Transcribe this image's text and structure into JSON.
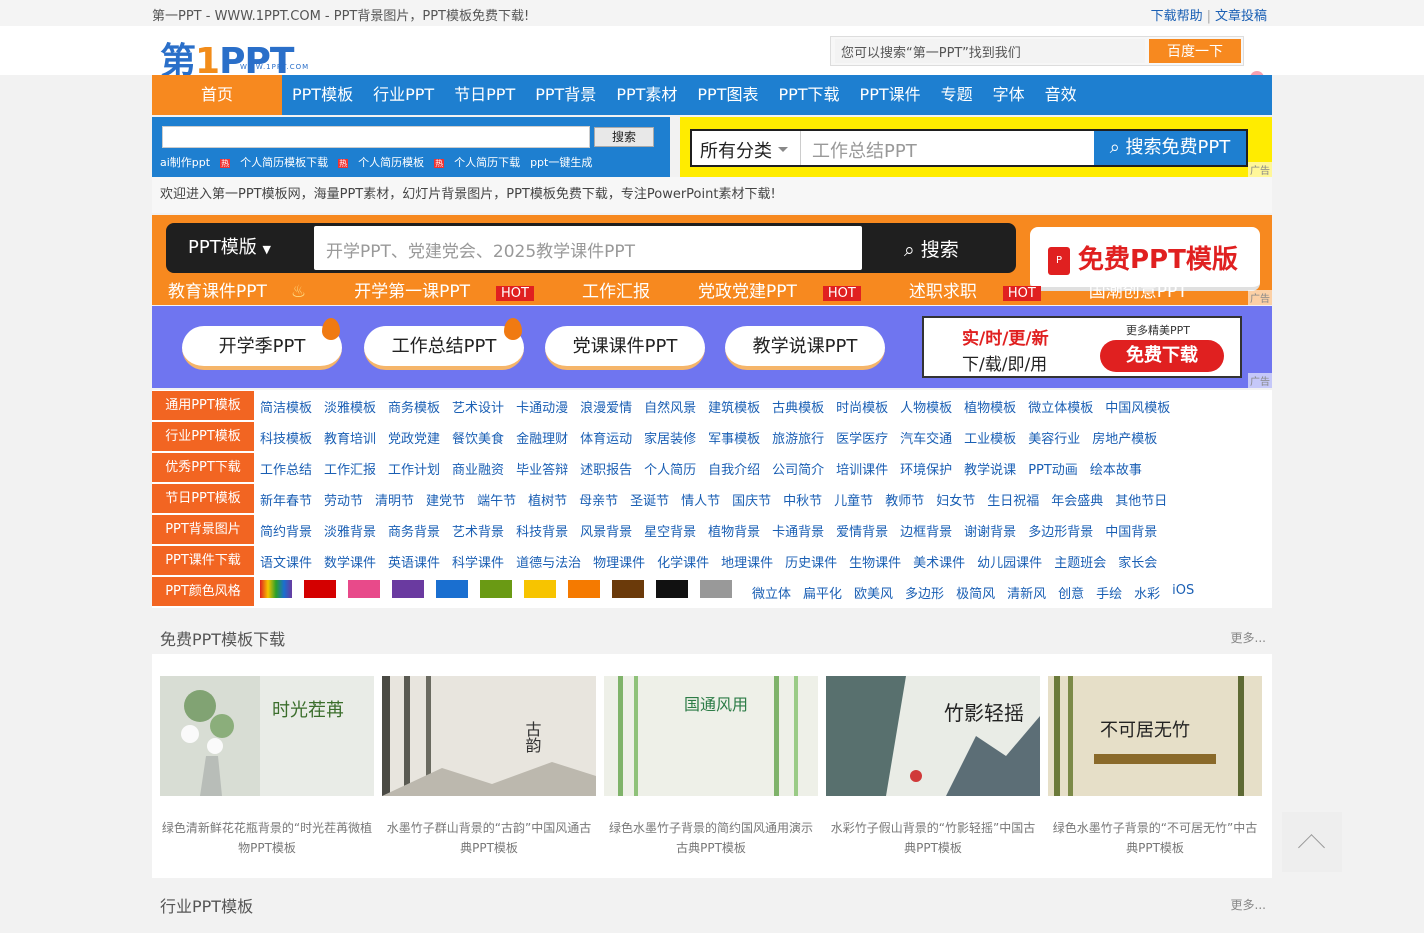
{
  "topbar": {
    "site_title": "第一PPT - WWW.1PPT.COM - PPT背景图片，PPT模板免费下载!",
    "help": "下载帮助",
    "sep": "|",
    "submit": "文章投稿"
  },
  "header": {
    "logo_main": "第",
    "logo_one": "1",
    "logo_ppt": "PPT",
    "logo_sub": "WWW.1PPT.COM",
    "search_placeholder": "您可以搜索“第一PPT”找到我们",
    "search_button": "百度一下"
  },
  "nav": {
    "home": "首页",
    "items": [
      "PPT模板",
      "行业PPT",
      "节日PPT",
      "PPT背景",
      "PPT素材",
      "PPT图表",
      "PPT下载",
      "PPT课件",
      "专题",
      "字体",
      "音效"
    ]
  },
  "searchbox": {
    "button": "搜索",
    "keywords": [
      "ai制作ppt",
      "个人简历模板下载",
      "个人简历模板",
      "个人简历下载",
      "ppt一键生成"
    ],
    "hot_badge": "热"
  },
  "ad1": {
    "category": "所有分类",
    "placeholder": "工作总结PPT",
    "button": "搜索免费PPT",
    "ad_label": "广告"
  },
  "welcome": "欢迎进入第一PPT模板网，海量PPT素材，幻灯片背景图片，PPT模板免费下载，专注PowerPoint素材下载!",
  "ad2": {
    "select": "PPT模版",
    "placeholder": "开学PPT、党建党会、2025教学课件PPT",
    "button": "搜索",
    "free": "免费PPT模版",
    "pdf_letter": "P",
    "tags": [
      {
        "label": "教育课件PPT",
        "badge": ""
      },
      {
        "label": "开学第一课PPT",
        "badge": "HOT"
      },
      {
        "label": "工作汇报",
        "badge": ""
      },
      {
        "label": "党政党建PPT",
        "badge": "HOT"
      },
      {
        "label": "述职求职",
        "badge": "HOT"
      },
      {
        "label": "国潮创意PPT",
        "badge": ""
      }
    ],
    "ad_label": "广告"
  },
  "ad3": {
    "pills": [
      "开学季PPT",
      "工作总结PPT",
      "党课课件PPT",
      "教学说课PPT"
    ],
    "promo_a": "实/时/更/新",
    "promo_b": "下/载/即/用",
    "promo_c": "更多精美PPT",
    "promo_d": "免费下载",
    "ad_label": "广告"
  },
  "categories": [
    {
      "label": "通用PPT模板",
      "links": [
        "简洁模板",
        "淡雅模板",
        "商务模板",
        "艺术设计",
        "卡通动漫",
        "浪漫爱情",
        "自然风景",
        "建筑模板",
        "古典模板",
        "时尚模板",
        "人物模板",
        "植物模板",
        "微立体模板",
        "中国风模板"
      ]
    },
    {
      "label": "行业PPT模板",
      "links": [
        "科技模板",
        "教育培训",
        "党政党建",
        "餐饮美食",
        "金融理财",
        "体育运动",
        "家居装修",
        "军事模板",
        "旅游旅行",
        "医学医疗",
        "汽车交通",
        "工业模板",
        "美容行业",
        "房地产模板"
      ]
    },
    {
      "label": "优秀PPT下载",
      "links": [
        "工作总结",
        "工作汇报",
        "工作计划",
        "商业融资",
        "毕业答辩",
        "述职报告",
        "个人简历",
        "自我介绍",
        "公司简介",
        "培训课件",
        "环境保护",
        "教学说课",
        "PPT动画",
        "绘本故事"
      ]
    },
    {
      "label": "节日PPT模板",
      "links": [
        "新年春节",
        "劳动节",
        "清明节",
        "建党节",
        "端午节",
        "植树节",
        "母亲节",
        "圣诞节",
        "情人节",
        "国庆节",
        "中秋节",
        "儿童节",
        "教师节",
        "妇女节",
        "生日祝福",
        "年会盛典",
        "其他节日"
      ]
    },
    {
      "label": "PPT背景图片",
      "links": [
        "简约背景",
        "淡雅背景",
        "商务背景",
        "艺术背景",
        "科技背景",
        "风景背景",
        "星空背景",
        "植物背景",
        "卡通背景",
        "爱情背景",
        "边框背景",
        "谢谢背景",
        "多边形背景",
        "中国背景"
      ]
    },
    {
      "label": "PPT课件下载",
      "links": [
        "语文课件",
        "数学课件",
        "英语课件",
        "科学课件",
        "道德与法治",
        "物理课件",
        "化学课件",
        "地理课件",
        "历史课件",
        "生物课件",
        "美术课件",
        "幼儿园课件",
        "主题班会",
        "家长会"
      ]
    },
    {
      "label": "PPT颜色风格",
      "links": [
        "微立体",
        "扁平化",
        "欧美风",
        "多边形",
        "极简风",
        "清新风",
        "创意",
        "手绘",
        "水彩",
        "iOS"
      ]
    }
  ],
  "colors": [
    "#d40000",
    "#e84a8a",
    "#6a3aa0",
    "#1a6fd0",
    "#6a9a14",
    "#f7c400",
    "#f57a00",
    "#6b3a0a",
    "#111111",
    "#999999"
  ],
  "section1": {
    "title": "免费PPT模板下载",
    "more": "更多..."
  },
  "cards": [
    {
      "caption": "绿色清新鲜花花瓶背景的“时光茬苒微植物PPT模板",
      "img_text": "时光茬苒"
    },
    {
      "caption": "水墨竹子群山背景的“古韵”中国风通古典PPT模板",
      "img_text": "古韵"
    },
    {
      "caption": "绿色水墨竹子背景的简约国风通用演示古典PPT模板",
      "img_text": "国通风用"
    },
    {
      "caption": "水彩竹子假山背景的“竹影轻摇”中国古典PPT模板",
      "img_text": "竹影轻摇"
    },
    {
      "caption": "绿色水墨竹子背景的“不可居无竹”中古典PPT模板",
      "img_text": "不可居无竹"
    }
  ],
  "section2": {
    "title": "行业PPT模板",
    "more": "更多..."
  }
}
